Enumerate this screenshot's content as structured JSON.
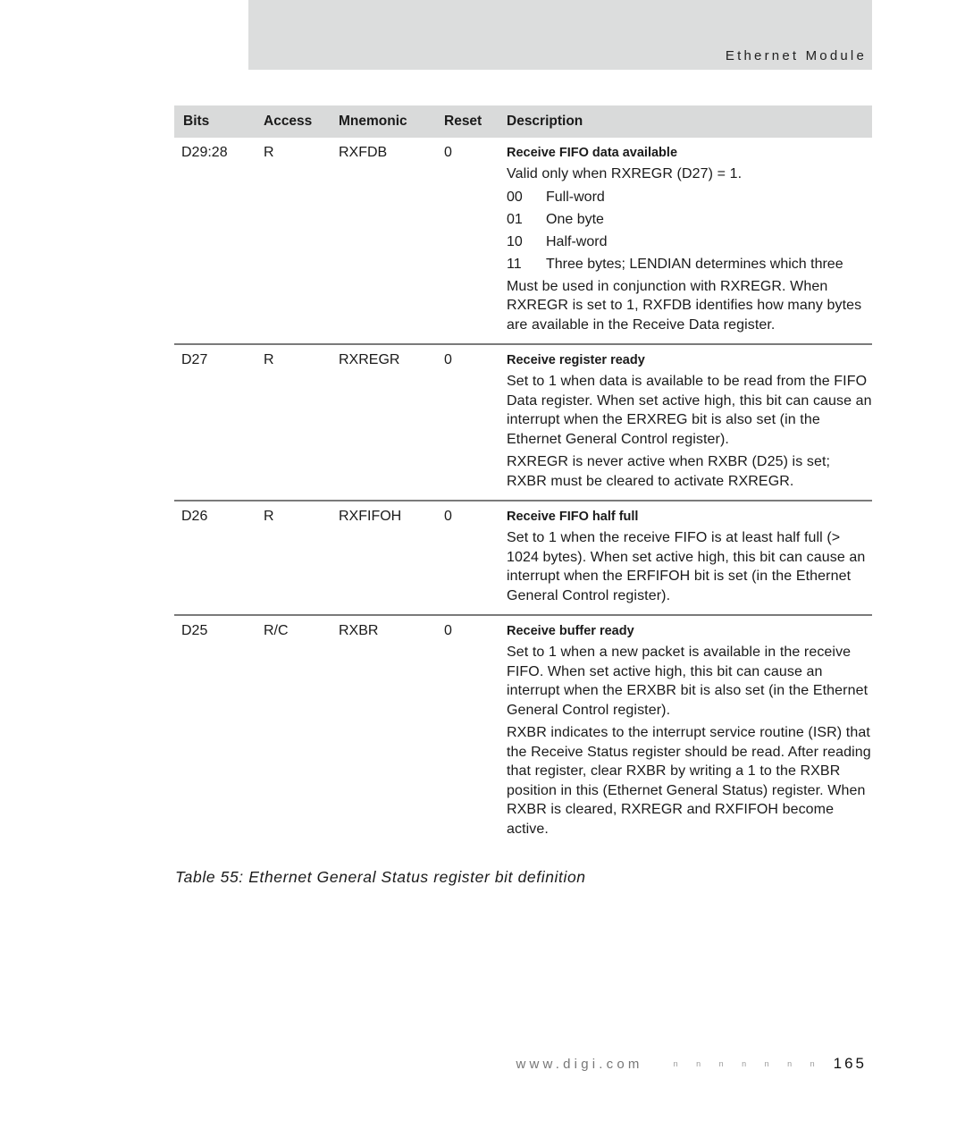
{
  "header": {
    "section_title": "Ethernet Module"
  },
  "table": {
    "columns": {
      "bits": "Bits",
      "access": "Access",
      "mnemonic": "Mnemonic",
      "reset": "Reset",
      "description": "Description"
    },
    "rows": [
      {
        "bits": "D29:28",
        "access": "R",
        "mnemonic": "RXFDB",
        "reset": "0",
        "title": "Receive FIFO data available",
        "intro": "Valid only when RXREGR (D27) = 1.",
        "enums": [
          {
            "code": "00",
            "text": "Full-word"
          },
          {
            "code": "01",
            "text": "One byte"
          },
          {
            "code": "10",
            "text": "Half-word"
          },
          {
            "code": "11",
            "text": "Three bytes; LENDIAN determines which three"
          }
        ],
        "paragraphs": [
          "Must be used in conjunction with RXREGR. When RXREGR is set to 1, RXFDB identifies how many bytes are available in the Receive Data register."
        ]
      },
      {
        "bits": "D27",
        "access": "R",
        "mnemonic": "RXREGR",
        "reset": "0",
        "title": "Receive register ready",
        "paragraphs": [
          "Set to 1 when data is available to be read from the FIFO Data register. When set active high, this bit can cause an interrupt when the ERXREG bit is also set (in the Ethernet General Control register).",
          "RXREGR is never active when RXBR (D25) is set; RXBR must be cleared to activate RXREGR."
        ]
      },
      {
        "bits": "D26",
        "access": "R",
        "mnemonic": "RXFIFOH",
        "reset": "0",
        "title": "Receive FIFO half full",
        "paragraphs": [
          "Set to 1 when the receive FIFO is at least half full (> 1024 bytes). When set active high, this bit can cause an interrupt when the ERFIFOH bit is set (in the Ethernet General Control register)."
        ]
      },
      {
        "bits": "D25",
        "access": "R/C",
        "mnemonic": "RXBR",
        "reset": "0",
        "title": "Receive buffer ready",
        "paragraphs": [
          "Set to 1 when a new packet is available in the receive FIFO. When set active high, this bit can cause an interrupt when the ERXBR bit is also set (in the Ethernet General Control register).",
          "RXBR indicates to the interrupt service routine (ISR) that the Receive Status register should be read. After reading that register, clear RXBR by writing a 1 to the RXBR position in this (Ethernet General Status) register. When RXBR is cleared, RXREGR and RXFIFOH become active."
        ]
      }
    ]
  },
  "caption": "Table 55: Ethernet General Status register bit definition",
  "footer": {
    "url": "www.digi.com",
    "dots": "n n n n n n n",
    "page_number": "165"
  }
}
